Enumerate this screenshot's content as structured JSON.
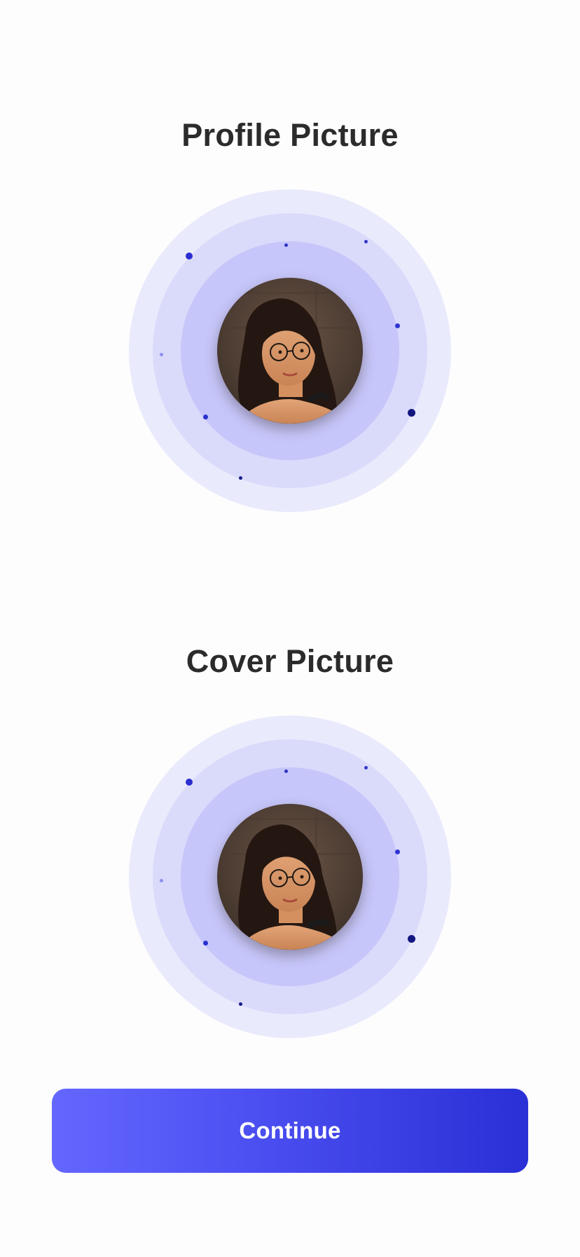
{
  "profile": {
    "title": "Profile Picture",
    "avatar_icon": "woman-portrait-photo"
  },
  "cover": {
    "title": "Cover Picture",
    "avatar_icon": "woman-portrait-photo"
  },
  "continue_button": {
    "label": "Continue"
  },
  "colors": {
    "title_text": "#2b2b2b",
    "ring_outer": "#eaeafd",
    "ring_middle": "#dadafb",
    "ring_inner": "#c6c6fa",
    "accent_dot": "#2b2fd0",
    "button_gradient_start": "#6467fe",
    "button_gradient_end": "#2a2fd6",
    "button_text": "#ffffff"
  }
}
